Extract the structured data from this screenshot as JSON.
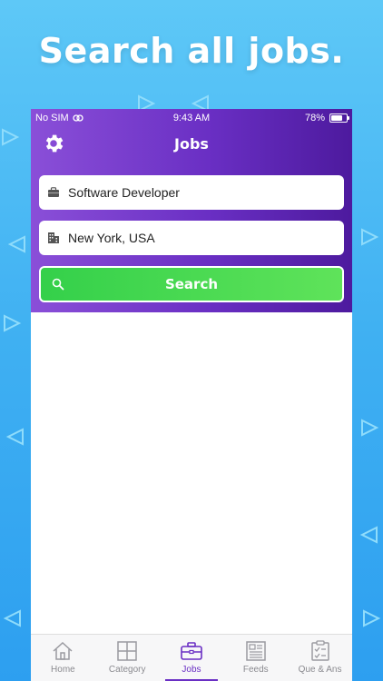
{
  "promo": {
    "headline": "Search all jobs."
  },
  "statusbar": {
    "carrier": "No SIM",
    "time": "9:43 AM",
    "battery": "78%",
    "battery_level": 0.78
  },
  "header": {
    "title": "Jobs"
  },
  "search": {
    "job_title_value": "Software Developer",
    "location_value": "New York, USA",
    "button_label": "Search"
  },
  "tabbar": {
    "active_tab": "Jobs",
    "items": [
      {
        "label": "Home",
        "icon": "home-icon"
      },
      {
        "label": "Category",
        "icon": "grid-icon"
      },
      {
        "label": "Jobs",
        "icon": "briefcase-icon"
      },
      {
        "label": "Feeds",
        "icon": "newspaper-icon"
      },
      {
        "label": "Que & Ans",
        "icon": "checklist-icon"
      }
    ]
  },
  "colors": {
    "background": "#3fb0f2",
    "header_start": "#8a4fd8",
    "header_end": "#4d1a9e",
    "search_button": "#4fd950",
    "active_tab": "#6a2fc4"
  }
}
